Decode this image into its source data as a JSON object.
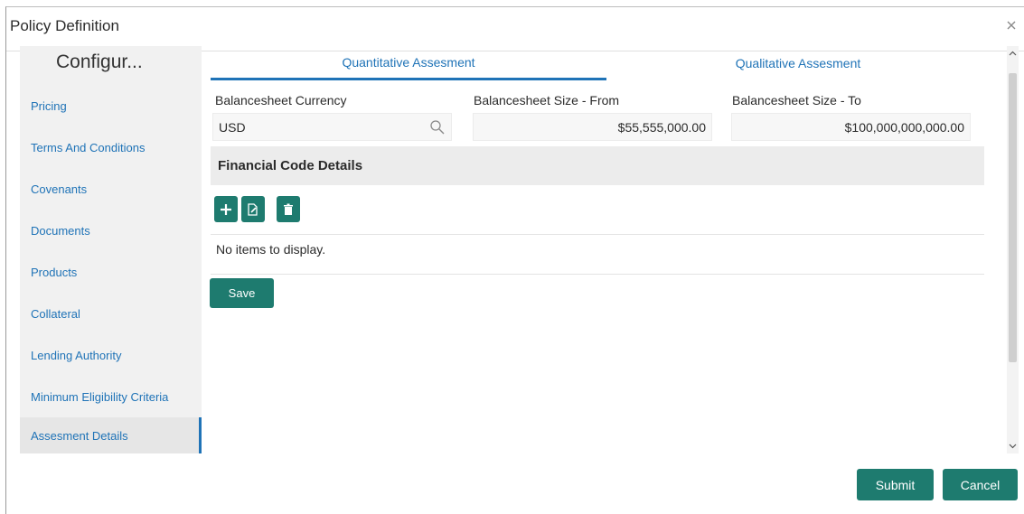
{
  "dialog": {
    "title": "Policy Definition",
    "close_icon": "close-icon"
  },
  "sidebar": {
    "title": "Configur...",
    "items": [
      {
        "label": "Pricing"
      },
      {
        "label": "Terms And Conditions"
      },
      {
        "label": "Covenants"
      },
      {
        "label": "Documents"
      },
      {
        "label": "Products"
      },
      {
        "label": "Collateral"
      },
      {
        "label": "Lending Authority"
      },
      {
        "label": "Minimum Eligibility Criteria"
      },
      {
        "label": "Assesment Details"
      }
    ],
    "active_item": "Assesment Details"
  },
  "tabs": [
    {
      "label": "Quantitative Assesment",
      "active": true
    },
    {
      "label": "Qualitative Assesment",
      "active": false
    }
  ],
  "fields": {
    "currency": {
      "label": "Balancesheet Currency",
      "value": "USD",
      "icon": "search-icon"
    },
    "size_from": {
      "label": "Balancesheet Size - From",
      "value": "$55,555,000.00"
    },
    "size_to": {
      "label": "Balancesheet Size - To",
      "value": "$100,000,000,000.00"
    }
  },
  "financial_code": {
    "title": "Financial Code Details",
    "toolbar_icons": [
      "add-icon",
      "edit-icon",
      "delete-icon"
    ],
    "empty_message": "No items to display.",
    "save_label": "Save"
  },
  "footer": {
    "submit_label": "Submit",
    "cancel_label": "Cancel"
  },
  "colors": {
    "accent": "#1f73b7",
    "button": "#1e7b6f",
    "sidebar_bg": "#f1f1f1"
  }
}
